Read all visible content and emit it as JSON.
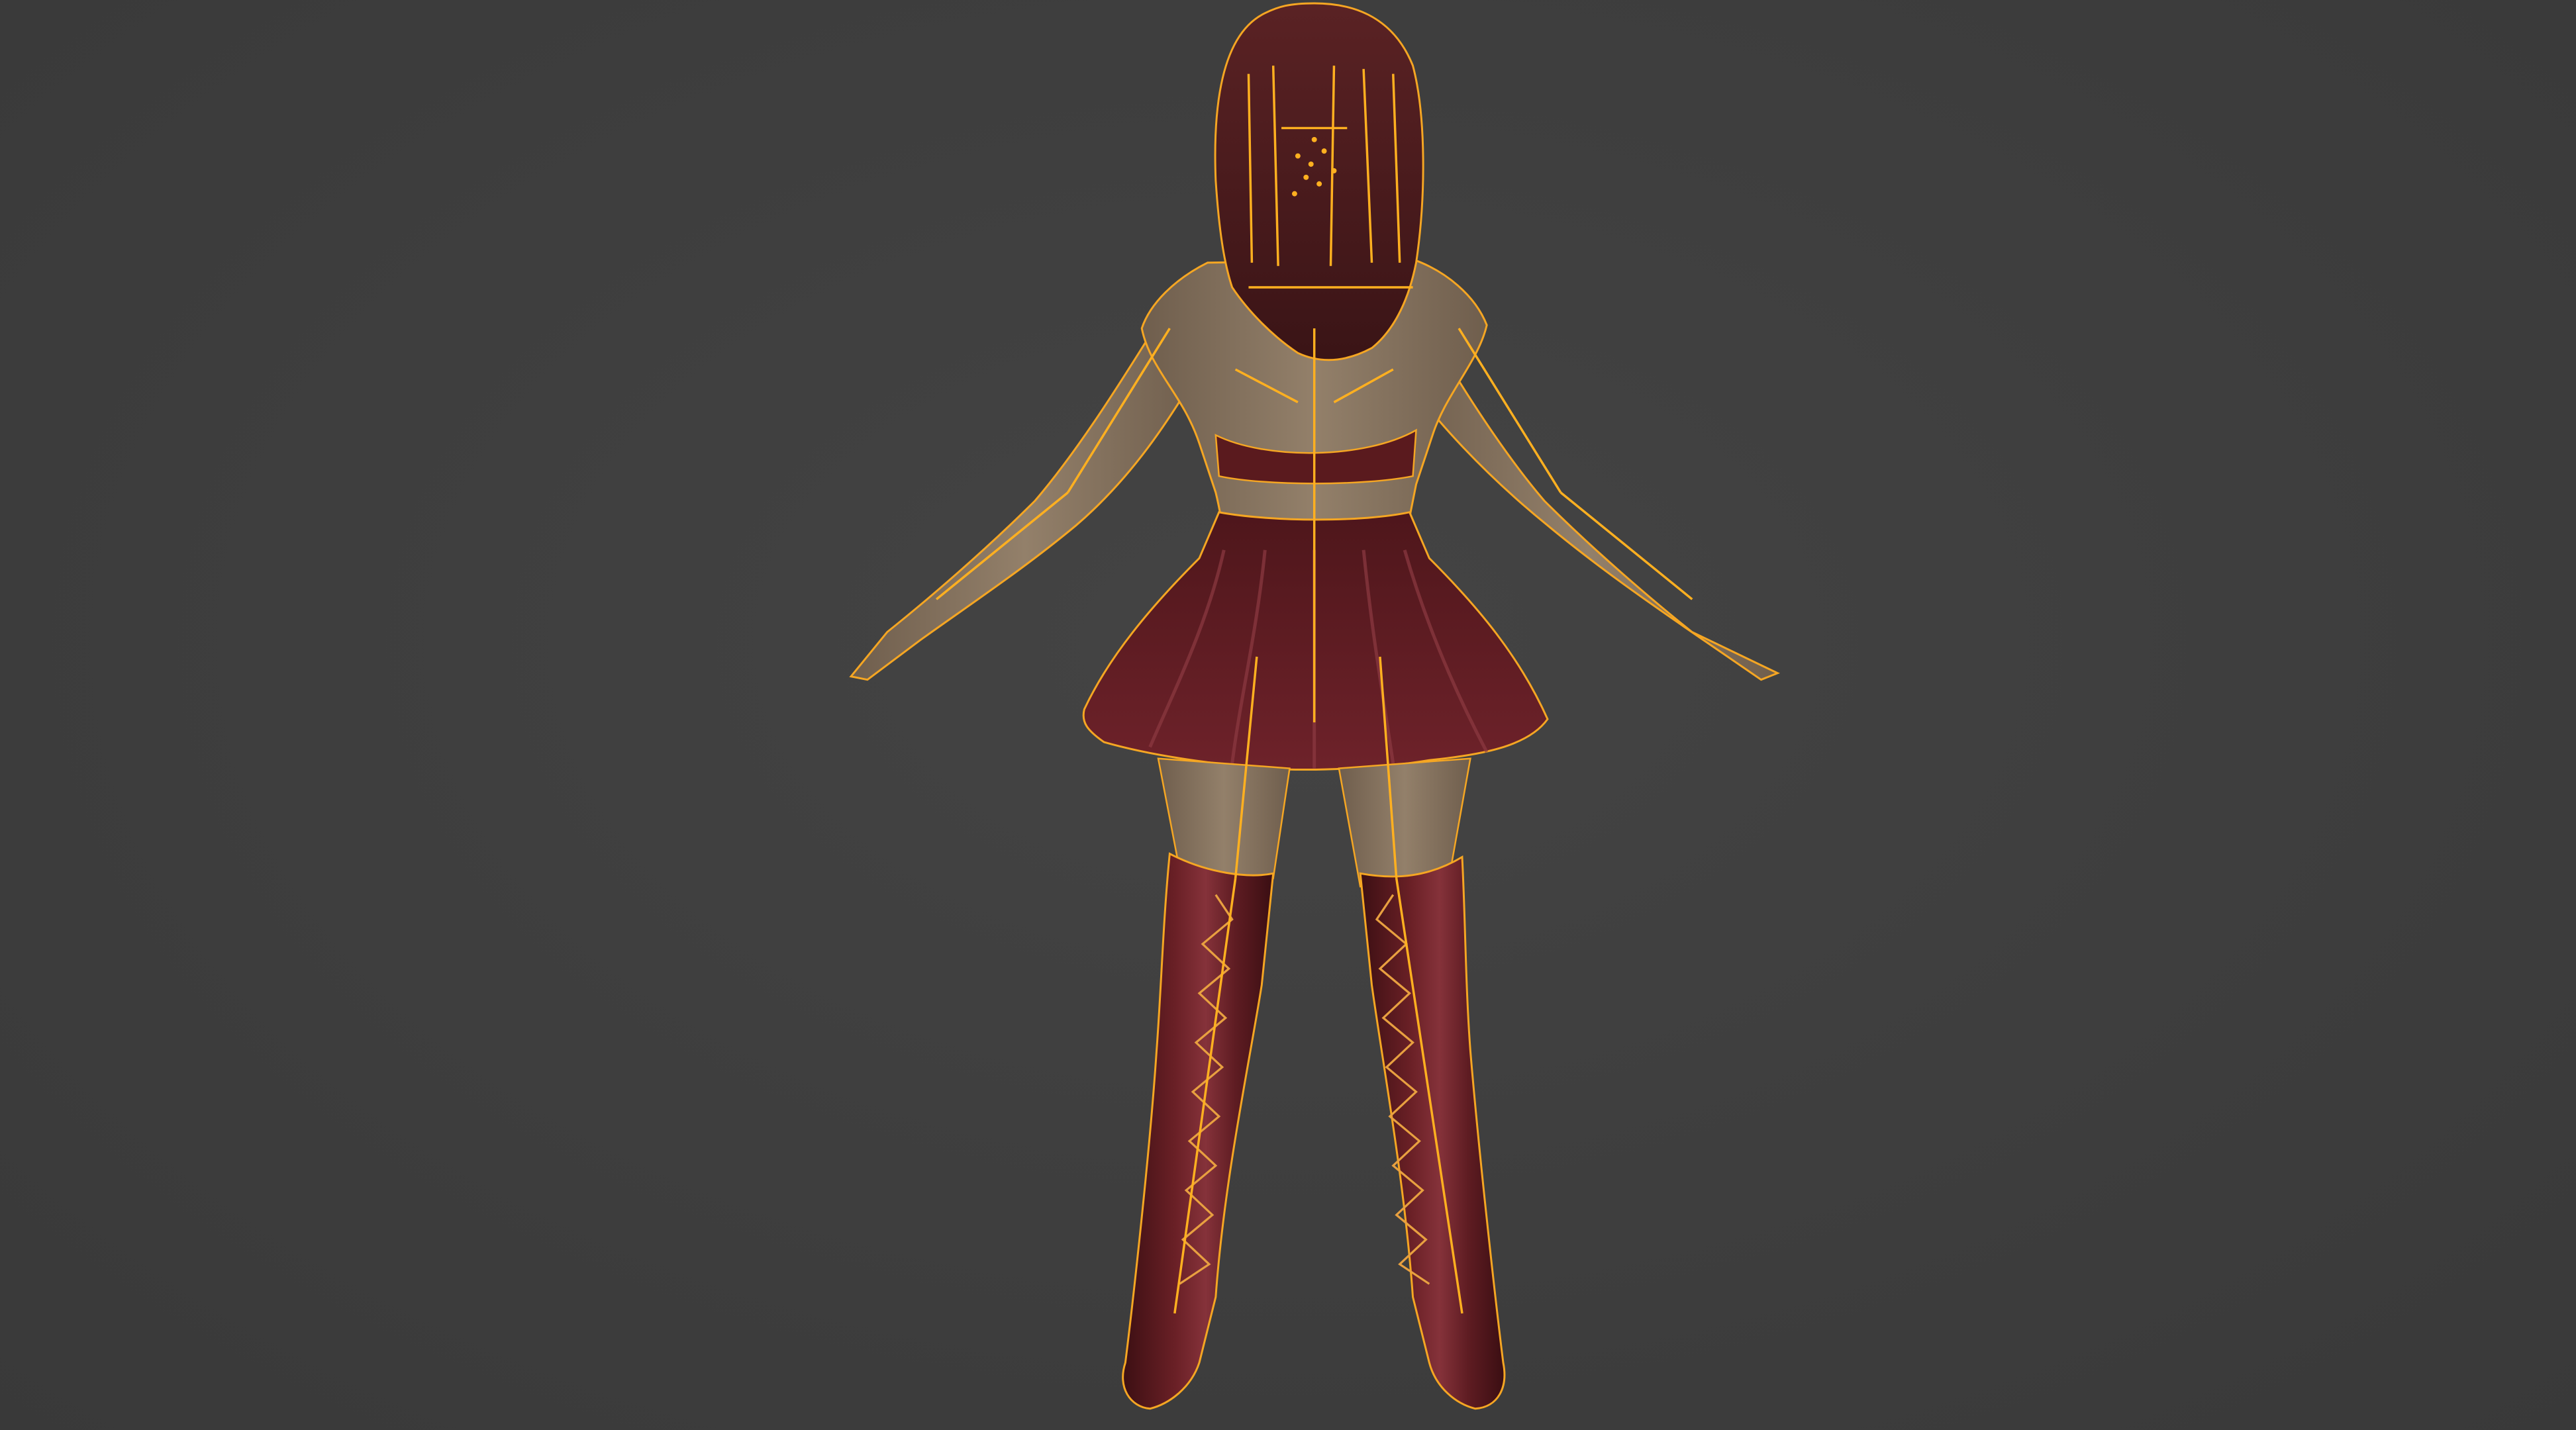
{
  "viewport": {
    "background_color": "#3d3d3d",
    "mode": "3d-viewport-back-view"
  },
  "model": {
    "subject": "character-model-back-view",
    "selected": true,
    "selection_outline_color": "#f5a623",
    "armature_color": "#ffb020",
    "skin_color": "#8a7560",
    "garment_color": "#5a1a1e",
    "hair_color": "#4a1c1e"
  }
}
